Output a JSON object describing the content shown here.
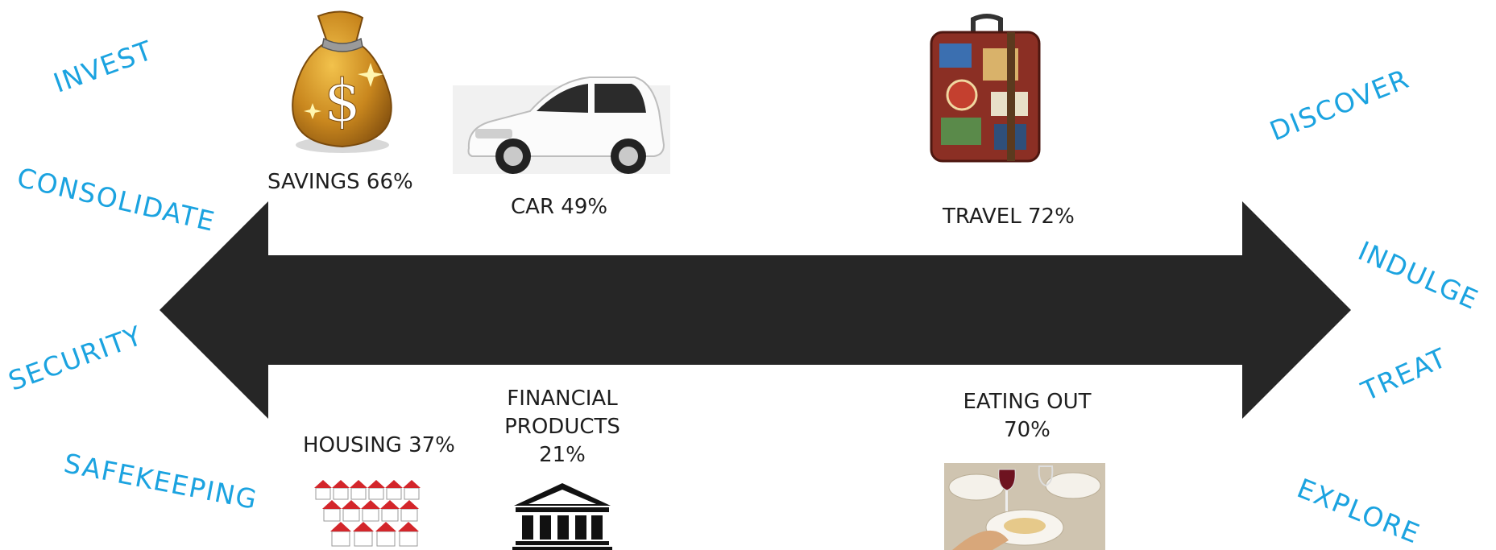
{
  "left_words": [
    "INVEST",
    "CONSOLIDATE",
    "SECURITY",
    "SAFEKEEPING"
  ],
  "right_words": [
    "DISCOVER",
    "INDULGE",
    "TREAT",
    "EXPLORE"
  ],
  "items": {
    "savings": "SAVINGS 66%",
    "car": "CAR 49%",
    "travel": "TRAVEL 72%",
    "housing": "HOUSING 37%",
    "financial": [
      "FINANCIAL",
      "PRODUCTS",
      "21%"
    ],
    "eating": [
      "EATING OUT",
      "70%"
    ]
  },
  "icons": [
    "money-bag-icon",
    "car-icon",
    "suitcase-icon",
    "houses-icon",
    "bank-building-icon",
    "dining-table-icon"
  ],
  "colors": {
    "accent": "#1ba3e0",
    "arrow": "#262626",
    "text": "#1e1e1e"
  }
}
